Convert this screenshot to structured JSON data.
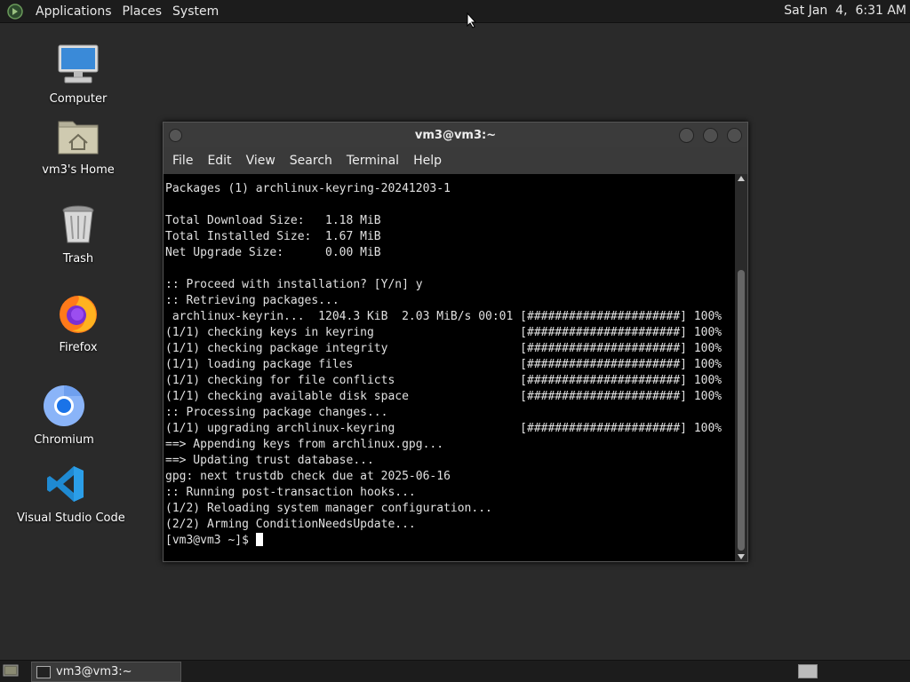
{
  "top_panel": {
    "menus": [
      "Applications",
      "Places",
      "System"
    ],
    "clock": "Sat Jan  4,  6:31 AM"
  },
  "desktop_icons": [
    {
      "label": "Computer",
      "icon": "computer-icon"
    },
    {
      "label": "vm3's Home",
      "icon": "home-folder-icon"
    },
    {
      "label": "Trash",
      "icon": "trash-icon"
    },
    {
      "label": "Firefox",
      "icon": "firefox-icon"
    },
    {
      "label": "Chromium",
      "icon": "chromium-icon"
    },
    {
      "label": "Visual Studio Code",
      "icon": "vscode-icon"
    }
  ],
  "terminal": {
    "title": "vm3@vm3:~",
    "menu": [
      "File",
      "Edit",
      "View",
      "Search",
      "Terminal",
      "Help"
    ],
    "lines": [
      "Packages (1) archlinux-keyring-20241203-1",
      "",
      "Total Download Size:   1.18 MiB",
      "Total Installed Size:  1.67 MiB",
      "Net Upgrade Size:      0.00 MiB",
      "",
      ":: Proceed with installation? [Y/n] y",
      ":: Retrieving packages...",
      " archlinux-keyrin...  1204.3 KiB  2.03 MiB/s 00:01 [######################] 100%",
      "(1/1) checking keys in keyring                     [######################] 100%",
      "(1/1) checking package integrity                   [######################] 100%",
      "(1/1) loading package files                        [######################] 100%",
      "(1/1) checking for file conflicts                  [######################] 100%",
      "(1/1) checking available disk space                [######################] 100%",
      ":: Processing package changes...",
      "(1/1) upgrading archlinux-keyring                  [######################] 100%",
      "==> Appending keys from archlinux.gpg...",
      "==> Updating trust database...",
      "gpg: next trustdb check due at 2025-06-16",
      ":: Running post-transaction hooks...",
      "(1/2) Reloading system manager configuration...",
      "(2/2) Arming ConditionNeedsUpdate..."
    ],
    "prompt": "[vm3@vm3 ~]$ "
  },
  "taskbar": {
    "window_button": "vm3@vm3:~"
  }
}
